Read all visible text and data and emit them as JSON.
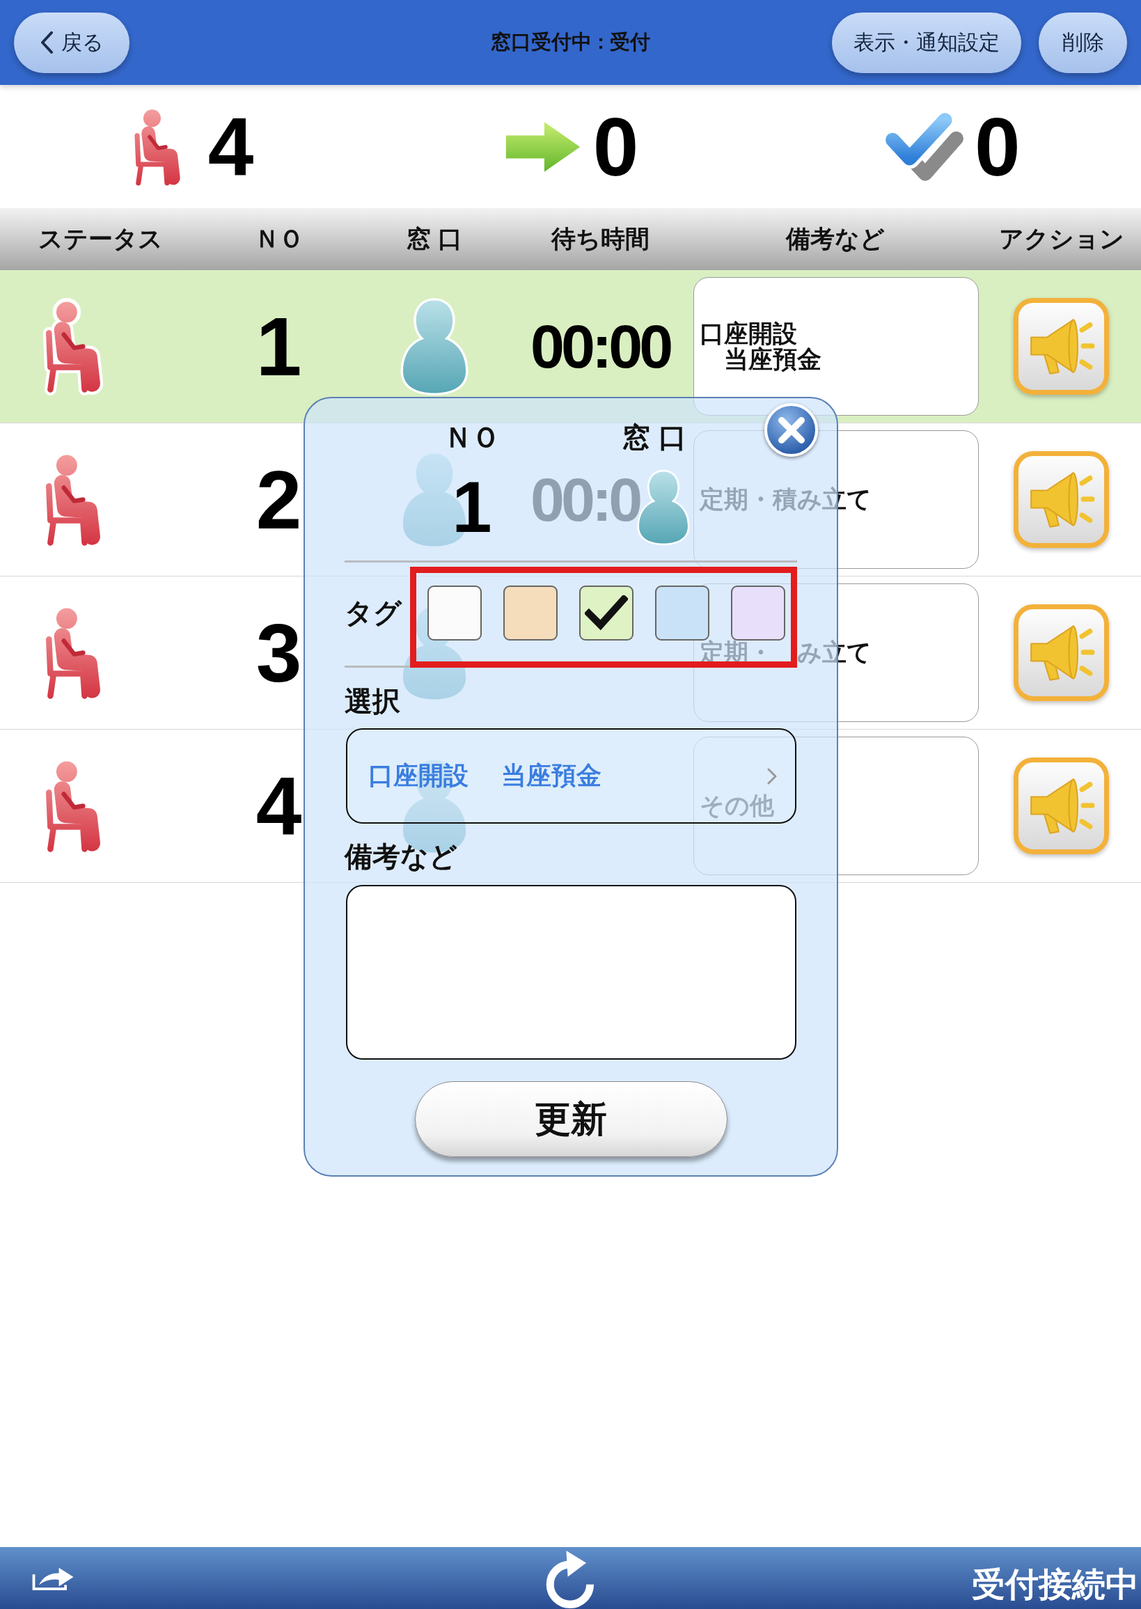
{
  "nav_bar": {
    "back_button": "戻る",
    "title": "窓口受付中 : 受付",
    "buttons": [
      "表示・通知設定",
      "削除"
    ]
  },
  "summary": [
    {
      "kind": "waiting",
      "count": "4"
    },
    {
      "kind": "called",
      "count": "0"
    },
    {
      "kind": "done",
      "count": "0"
    }
  ],
  "table": {
    "columns": [
      "ステータス",
      "ＮＯ",
      "窓 口",
      "待ち時間",
      "備考など",
      "アクション"
    ],
    "rows": [
      {
        "selected": true,
        "no": "1",
        "wait_time": "00:00",
        "notes": [
          "口座開設",
          "当座預金"
        ]
      },
      {
        "selected": false,
        "no": "2",
        "wait_time": "00:0",
        "notes": [
          "定期・積み立て"
        ]
      },
      {
        "selected": false,
        "no": "3",
        "notes": [
          [
            "定期・",
            "み立て"
          ]
        ]
      },
      {
        "selected": false,
        "no": "4",
        "notes": [
          "その他"
        ]
      }
    ]
  },
  "dialog": {
    "no_label": "ＮＯ",
    "window_label": "窓 口",
    "no": "1",
    "tag_label": "タグ",
    "tags": {
      "highlighted": true,
      "items": [
        {
          "color": "#fbfbfb",
          "checked": false
        },
        {
          "color": "#f5dcbb",
          "checked": false
        },
        {
          "color": "#dff2c4",
          "checked": true
        },
        {
          "color": "#c9e2f8",
          "checked": false
        },
        {
          "color": "#e8e0fa",
          "checked": false
        }
      ]
    },
    "select_label": "選択",
    "select_values": [
      "口座開設",
      "当座預金"
    ],
    "notes_label": "備考など",
    "update_button": "更新"
  },
  "status_bar": {
    "text": "受付接続中"
  }
}
